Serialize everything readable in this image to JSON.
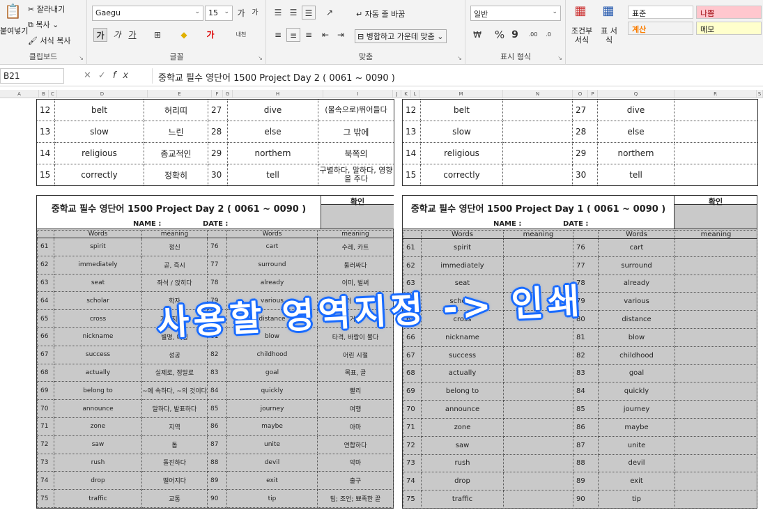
{
  "ribbon": {
    "clipboard": {
      "paste": "붙여넣기",
      "cut": "잘라내기",
      "copy": "복사",
      "format_painter": "서식 복사",
      "group_label": "클립보드"
    },
    "font": {
      "font_name": "Gaegu",
      "font_size": "15",
      "grow": "가",
      "shrink": "가",
      "bold": "가",
      "italic": "가",
      "underline": "가",
      "group_label": "글꼴"
    },
    "alignment": {
      "wrap_text": "자동 줄 바꿈",
      "merge_center": "병합하고 가운데 맞춤",
      "group_label": "맞춤"
    },
    "number": {
      "format": "일반",
      "percent": "%",
      "comma": "9",
      "group_label": "표시 형식"
    },
    "styles": {
      "conditional": "조건부 서식",
      "table": "표 서식",
      "normal": "표준",
      "bad": "나쁨",
      "calc": "계산",
      "note": "메모"
    }
  },
  "formula_bar": {
    "name_box": "B21",
    "formula": "중학교 필수 영단어 1500 Project Day 2 ( 0061 ~ 0090 )"
  },
  "columns": [
    "A",
    "B",
    "C",
    "D",
    "E",
    "F",
    "G",
    "H",
    "I",
    "J",
    "K",
    "L",
    "M",
    "N",
    "O",
    "P",
    "Q",
    "R",
    "S"
  ],
  "top_left": [
    {
      "n": "12",
      "w": "belt",
      "m": "허리띠",
      "n2": "27",
      "w2": "dive",
      "m2": "(물속으로)뛰어들다"
    },
    {
      "n": "13",
      "w": "slow",
      "m": "느린",
      "n2": "28",
      "w2": "else",
      "m2": "그 밖에"
    },
    {
      "n": "14",
      "w": "religious",
      "m": "종교적인",
      "n2": "29",
      "w2": "northern",
      "m2": "북쪽의"
    },
    {
      "n": "15",
      "w": "correctly",
      "m": "정확히",
      "n2": "30",
      "w2": "tell",
      "m2": "구별하다, 말하다, 영향을 주다"
    }
  ],
  "top_right": [
    {
      "n": "12",
      "w": "belt",
      "n2": "27",
      "w2": "dive"
    },
    {
      "n": "13",
      "w": "slow",
      "n2": "28",
      "w2": "else"
    },
    {
      "n": "14",
      "w": "religious",
      "n2": "29",
      "w2": "northern"
    },
    {
      "n": "15",
      "w": "correctly",
      "n2": "30",
      "w2": "tell"
    }
  ],
  "left_sheet": {
    "title": "중학교 필수 영단어 1500 Project Day 2 ( 0061 ~ 0090 )",
    "name_label": "NAME :",
    "date_label": "DATE :",
    "confirm": "확인",
    "h_words": "Words",
    "h_meaning": "meaning",
    "rows": [
      {
        "n": "61",
        "w": "spirit",
        "m": "정신",
        "n2": "76",
        "w2": "cart",
        "m2": "수레, 카트"
      },
      {
        "n": "62",
        "w": "immediately",
        "m": "곧, 즉시",
        "n2": "77",
        "w2": "surround",
        "m2": "둘러싸다"
      },
      {
        "n": "63",
        "w": "seat",
        "m": "좌석 / 앉히다",
        "n2": "78",
        "w2": "already",
        "m2": "이미, 벌써"
      },
      {
        "n": "64",
        "w": "scholar",
        "m": "학자",
        "n2": "79",
        "w2": "various",
        "m2": "여러 가지의"
      },
      {
        "n": "65",
        "w": "cross",
        "m": "가로지르다",
        "n2": "80",
        "w2": "distance",
        "m2": "거리"
      },
      {
        "n": "66",
        "w": "nickname",
        "m": "별명, 애칭",
        "n2": "81",
        "w2": "blow",
        "m2": "타격, 바람이 불다"
      },
      {
        "n": "67",
        "w": "success",
        "m": "성공",
        "n2": "82",
        "w2": "childhood",
        "m2": "어린 시절"
      },
      {
        "n": "68",
        "w": "actually",
        "m": "실제로, 정말로",
        "n2": "83",
        "w2": "goal",
        "m2": "목표, 골"
      },
      {
        "n": "69",
        "w": "belong to",
        "m": "~에 속하다, ~의 것이다",
        "n2": "84",
        "w2": "quickly",
        "m2": "빨리"
      },
      {
        "n": "70",
        "w": "announce",
        "m": "말하다, 발표하다",
        "n2": "85",
        "w2": "journey",
        "m2": "여행"
      },
      {
        "n": "71",
        "w": "zone",
        "m": "지역",
        "n2": "86",
        "w2": "maybe",
        "m2": "아마"
      },
      {
        "n": "72",
        "w": "saw",
        "m": "톱",
        "n2": "87",
        "w2": "unite",
        "m2": "연합하다"
      },
      {
        "n": "73",
        "w": "rush",
        "m": "돌진하다",
        "n2": "88",
        "w2": "devil",
        "m2": "악마"
      },
      {
        "n": "74",
        "w": "drop",
        "m": "떨어지다",
        "n2": "89",
        "w2": "exit",
        "m2": "출구"
      },
      {
        "n": "75",
        "w": "traffic",
        "m": "교통",
        "n2": "90",
        "w2": "tip",
        "m2": "팁; 조언; 뾰족한 끝"
      }
    ]
  },
  "right_sheet": {
    "title": "중학교 필수 영단어 1500 Project Day 1 ( 0061 ~ 0090 )",
    "name_label": "NAME :",
    "date_label": "DATE :",
    "confirm": "확인",
    "h_words": "Words",
    "h_meaning": "meaning",
    "rows": [
      {
        "n": "61",
        "w": "spirit",
        "n2": "76",
        "w2": "cart"
      },
      {
        "n": "62",
        "w": "immediately",
        "n2": "77",
        "w2": "surround"
      },
      {
        "n": "63",
        "w": "seat",
        "n2": "78",
        "w2": "already"
      },
      {
        "n": "64",
        "w": "scholar",
        "n2": "79",
        "w2": "various"
      },
      {
        "n": "65",
        "w": "cross",
        "n2": "80",
        "w2": "distance"
      },
      {
        "n": "66",
        "w": "nickname",
        "n2": "81",
        "w2": "blow"
      },
      {
        "n": "67",
        "w": "success",
        "n2": "82",
        "w2": "childhood"
      },
      {
        "n": "68",
        "w": "actually",
        "n2": "83",
        "w2": "goal"
      },
      {
        "n": "69",
        "w": "belong to",
        "n2": "84",
        "w2": "quickly"
      },
      {
        "n": "70",
        "w": "announce",
        "n2": "85",
        "w2": "journey"
      },
      {
        "n": "71",
        "w": "zone",
        "n2": "86",
        "w2": "maybe"
      },
      {
        "n": "72",
        "w": "saw",
        "n2": "87",
        "w2": "unite"
      },
      {
        "n": "73",
        "w": "rush",
        "n2": "88",
        "w2": "devil"
      },
      {
        "n": "74",
        "w": "drop",
        "n2": "89",
        "w2": "exit"
      },
      {
        "n": "75",
        "w": "traffic",
        "n2": "90",
        "w2": "tip"
      }
    ]
  },
  "overlay_text": "사용할 영역지정 -> 인쇄"
}
